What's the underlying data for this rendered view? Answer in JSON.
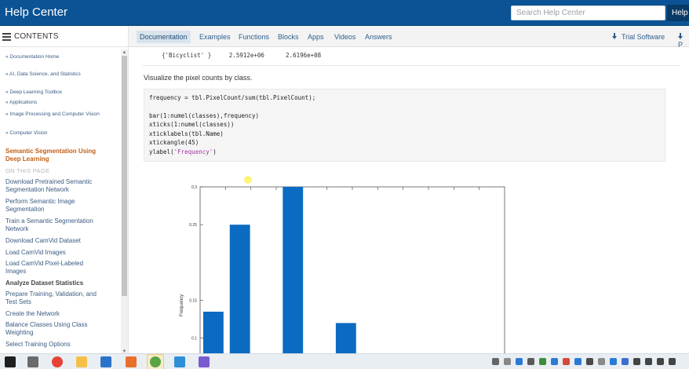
{
  "header": {
    "title": "Help Center",
    "search_placeholder": "Search Help Center",
    "help_button": "Help"
  },
  "sidebar": {
    "contents_label": "CONTENTS",
    "breadcrumbs": [
      "« Documentation Home",
      "« AI, Data Science, and Statistics",
      "« Deep Learning Toolbox",
      "« Applications",
      "« Image Processing and Computer Vision",
      "« Computer Vision"
    ],
    "active_title": "Semantic Segmentation Using Deep Learning",
    "on_this_page": "ON THIS PAGE",
    "items": [
      "Download Pretrained Semantic Segmentation Network",
      "Perform Semantic Image Segmentation",
      "Train a Semantic Segmentation Network",
      "Download CamVid Dataset",
      "Load CamVid Images",
      "Load CamVid Pixel-Labeled Images",
      "Analyze Dataset Statistics",
      "Prepare Training, Validation, and Test Sets",
      "Create the Network",
      "Balance Classes Using Class Weighting",
      "Select Training Options"
    ]
  },
  "tabs": {
    "items": [
      "Documentation",
      "Examples",
      "Functions",
      "Blocks",
      "Apps",
      "Videos",
      "Answers"
    ],
    "active": "Documentation",
    "trial": "Trial Software",
    "right_cut": "P"
  },
  "content": {
    "output_line": "{'Bicyclist' }     2.5912e+06      2.6196e+08",
    "paragraph": "Visualize the pixel counts by class.",
    "code": [
      "frequency = tbl.PixelCount/sum(tbl.PixelCount);",
      "",
      "bar(1:numel(classes),frequency)",
      "xticks(1:numel(classes))",
      "xticklabels(tbl.Name)",
      "xtickangle(45)"
    ],
    "code_last_prefix": "ylabel(",
    "code_last_string": "'Frequency'",
    "code_last_suffix": ")"
  },
  "chart_data": {
    "type": "bar",
    "ylabel": "Frequency",
    "yticks": [
      "0.1",
      "0.15",
      "0.25",
      "0.3"
    ],
    "ylim": [
      0.08,
      0.3
    ],
    "bar_color": "#0b6bc2",
    "values": [
      0.135,
      0.25,
      0.3,
      0.12
    ],
    "bar_positions": [
      1,
      2,
      4,
      6
    ],
    "x_slots": 12
  },
  "taskbar": {
    "icons": [
      "windows-icon",
      "app-icon",
      "chrome-icon",
      "file-explorer-icon",
      "onenote-icon",
      "matlab-icon",
      "app-icon",
      "photos-icon",
      "app-icon",
      "app-icon"
    ]
  }
}
